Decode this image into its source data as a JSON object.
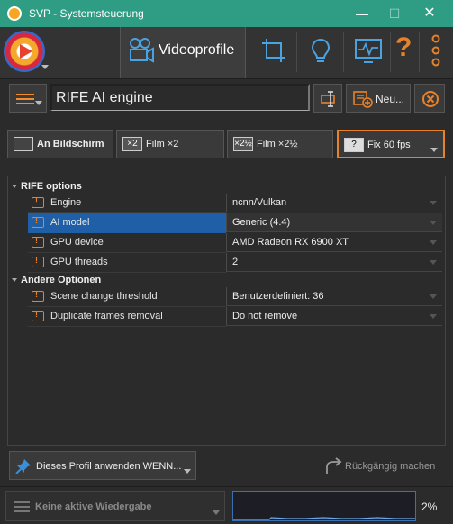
{
  "window": {
    "title": "SVP - Systemsteuerung",
    "minimize_glyph": "—",
    "maximize_glyph": "☐",
    "close_glyph": "✕"
  },
  "toolbar": {
    "active_tab_label": "Videoprofile",
    "items": [
      "crop-icon",
      "lightbulb-icon",
      "monitor-icon",
      "help-icon",
      "more-icon"
    ],
    "help_glyph": "?"
  },
  "profile": {
    "name": "RIFE AI engine",
    "new_label": "Neu..."
  },
  "output_tabs": [
    {
      "label": "An Bildschirm",
      "icon_text": "",
      "active": false
    },
    {
      "label": "Film ×2",
      "icon_text": "×2",
      "active": false
    },
    {
      "label": "Film ×2½",
      "icon_text": "×2½",
      "active": false
    },
    {
      "label": "Fix 60 fps",
      "icon_text": "?",
      "active": true
    }
  ],
  "settings": {
    "sections": [
      {
        "label": "RIFE options",
        "rows": [
          {
            "name": "Engine",
            "value": "ncnn/Vulkan",
            "selected": false
          },
          {
            "name": "AI model",
            "value": "Generic (4.4)",
            "selected": true
          },
          {
            "name": "GPU device",
            "value": "AMD Radeon RX 6900 XT",
            "selected": false
          },
          {
            "name": "GPU threads",
            "value": "2",
            "selected": false
          }
        ]
      },
      {
        "label": "Andere Optionen",
        "rows": [
          {
            "name": "Scene change threshold",
            "value": "Benutzerdefiniert: 36",
            "selected": false
          },
          {
            "name": "Duplicate frames removal",
            "value": "Do not remove",
            "selected": false
          }
        ]
      }
    ]
  },
  "bottom": {
    "condition_label": "Dieses Profil anwenden WENN...",
    "undo_label": "Rückgängig machen"
  },
  "status": {
    "playback_label": "Keine aktive Wiedergabe",
    "cpu_percent": "2%"
  },
  "colors": {
    "titlebar": "#2e9d83",
    "accent": "#e8822a",
    "selection": "#1f5fa8"
  }
}
